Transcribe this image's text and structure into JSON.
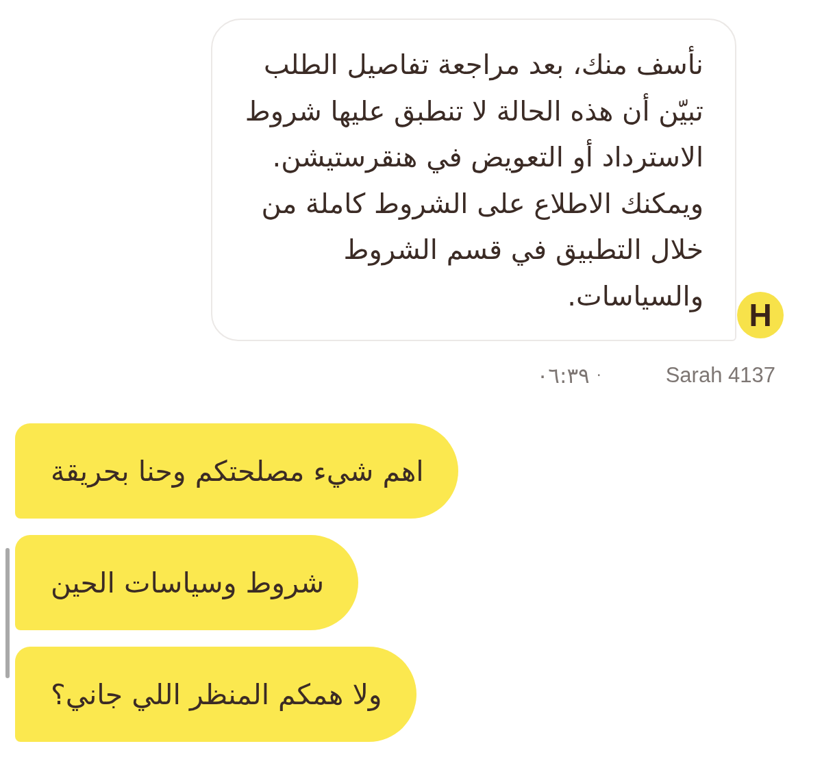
{
  "messages": [
    {
      "kind": "agent",
      "text": "نأسف منك، بعد مراجعة تفاصيل الطلب تبيّن أن هذه الحالة لا تنطبق عليها شروط الاسترداد أو التعويض في هنقرستيشن. ويمكنك الاطلاع على الشروط كاملة من خلال التطبيق في قسم الشروط والسياسات.",
      "avatar": "H",
      "sender": "Sarah 4137",
      "separator": "·",
      "time": "٠٦:٣٩"
    },
    {
      "kind": "user",
      "text": "اهم شيء مصلحتكم وحنا بحريقة"
    },
    {
      "kind": "user",
      "text": "شروط وسياسات الحين"
    },
    {
      "kind": "user",
      "text": "ولا همكم المنظر اللي جاني؟"
    }
  ]
}
